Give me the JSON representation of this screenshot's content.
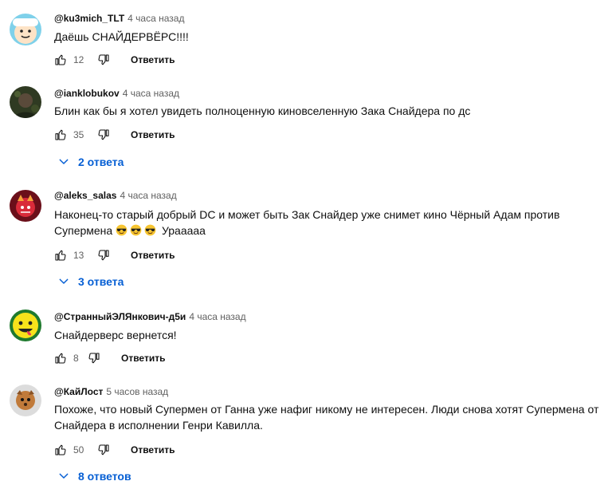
{
  "comments": [
    {
      "author": "@ku3mich_TLT",
      "time": "4 часа назад",
      "text": "Даёшь СНАЙДЕРВЁРС!!!!",
      "likes": "12",
      "reply_label": "Ответить",
      "avatar_color": "#6fc7e3"
    },
    {
      "author": "@ianklobukov",
      "time": "4 часа назад",
      "text": "Блин как бы я хотел увидеть полноценную киновселенную Зака Снайдера по дс",
      "likes": "35",
      "reply_label": "Ответить",
      "replies_label": "2 ответа",
      "avatar_color": "#3a4a2a"
    },
    {
      "author": "@aleks_salas",
      "time": "4 часа назад",
      "text_line1": "Наконец-то старый добрый DC и может быть Зак Снайдер уже снимет кино Чёрный Адам против",
      "text_line2_prefix": "Супермена",
      "text_line2_suffix": "Урааааа",
      "emoji": "smiling-face-with-sunglasses",
      "likes": "13",
      "reply_label": "Ответить",
      "replies_label": "3 ответа",
      "avatar_color": "#b81c2a"
    },
    {
      "author": "@СтранныйЭЛЯнкович-д5и",
      "time": "4 часа назад",
      "text": "Снайдерверс вернется!",
      "likes": "8",
      "reply_label": "Ответить",
      "avatar_color": "#f5e11a"
    },
    {
      "author": "@КайЛост",
      "time": "5 часов назад",
      "text": "Похоже, что новый Супермен от Ганна уже нафиг никому не интересен. Люди снова хотят Супермена от Снайдера в исполнении Генри Кавилла.",
      "likes": "50",
      "reply_label": "Ответить",
      "replies_label": "8 ответов",
      "avatar_color": "#d9d9d9"
    }
  ],
  "colors": {
    "link_blue": "#065fd4",
    "secondary_text": "#606060",
    "primary_text": "#0f0f0f"
  }
}
